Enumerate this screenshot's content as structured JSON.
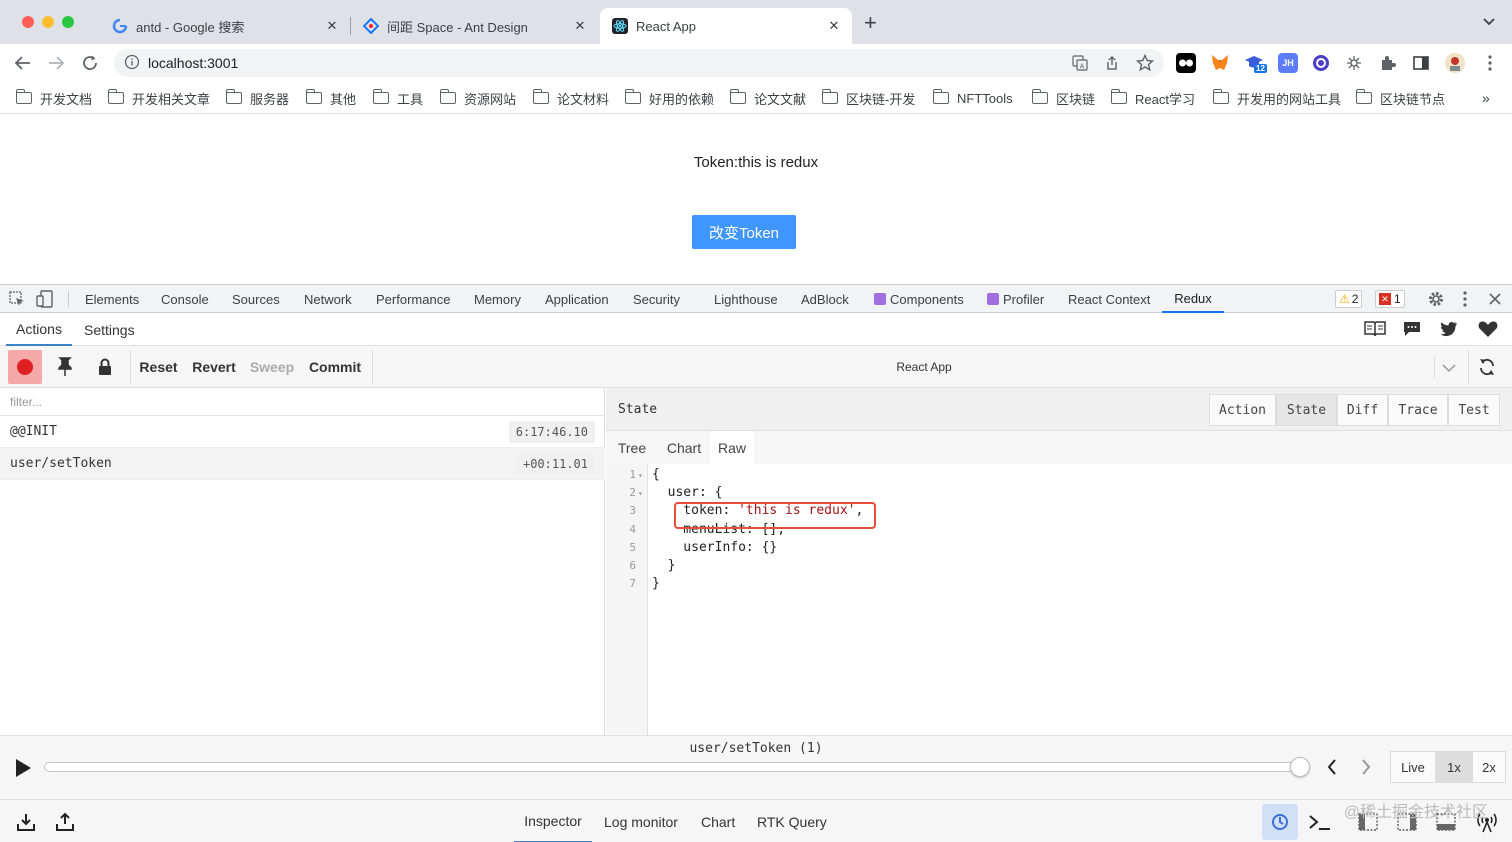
{
  "tabs": [
    {
      "title": "antd - Google 搜索",
      "icon": "google-icon"
    },
    {
      "title": "间距 Space - Ant Design",
      "icon": "antd-icon"
    },
    {
      "title": "React App",
      "icon": "react-icon",
      "active": true
    }
  ],
  "new_tab_symbol": "+",
  "tab_close_symbol": "✕",
  "url": "localhost:3001",
  "bookmarks": [
    "开发文档",
    "开发相关文章",
    "服务器",
    "其他",
    "工具",
    "资源网站",
    "论文材料",
    "好用的依赖",
    "论文文献",
    "区块链-开发",
    "NFTTools",
    "区块链",
    "React学习",
    "开发用的网站工具",
    "区块链节点"
  ],
  "bookmarks_overflow": "»",
  "extension_badge": "12",
  "page": {
    "token_text": "Token:this is redux",
    "change_button": "改变Token",
    "button_color": "#4096ff"
  },
  "devtools": {
    "tabs": [
      "Elements",
      "Console",
      "Sources",
      "Network",
      "Performance",
      "Memory",
      "Application",
      "Security",
      "Lighthouse",
      "AdBlock",
      "Components",
      "Profiler",
      "React Context",
      "Redux"
    ],
    "active_tab": "Redux",
    "warnings": "2",
    "errors": "1"
  },
  "redux": {
    "header_tabs": [
      "Actions",
      "Settings"
    ],
    "tool_buttons": {
      "reset": "Reset",
      "revert": "Revert",
      "sweep": "Sweep",
      "commit": "Commit"
    },
    "instance": "React App",
    "filter_placeholder": "filter...",
    "actions": [
      {
        "name": "@@INIT",
        "time": "6:17:46.10"
      },
      {
        "name": "user/setToken",
        "time": "+00:11.01"
      }
    ],
    "state_label": "State",
    "segments": [
      "Action",
      "State",
      "Diff",
      "Trace",
      "Test"
    ],
    "sub_tabs": [
      "Tree",
      "Chart",
      "Raw"
    ],
    "code_lines": [
      {
        "n": "1",
        "fold": "▾",
        "text": "{"
      },
      {
        "n": "2",
        "fold": "▾",
        "text": "  user: {"
      },
      {
        "n": "3",
        "fold": "",
        "text": "    token: ",
        "str": "'this is redux'",
        "tail": ","
      },
      {
        "n": "4",
        "fold": "",
        "text": "    menuList: [],"
      },
      {
        "n": "5",
        "fold": "",
        "text": "    userInfo: {}"
      },
      {
        "n": "6",
        "fold": "",
        "text": "  }"
      },
      {
        "n": "7",
        "fold": "",
        "text": "}"
      }
    ],
    "slider_label": "user/setToken  (1)",
    "slider_position": 1.0,
    "speed_buttons": [
      "Live",
      "1x",
      "2x"
    ],
    "bottom_tabs": [
      "Inspector",
      "Log monitor",
      "Chart",
      "RTK Query"
    ],
    "watermark": "@稀土掘金技术社区"
  }
}
